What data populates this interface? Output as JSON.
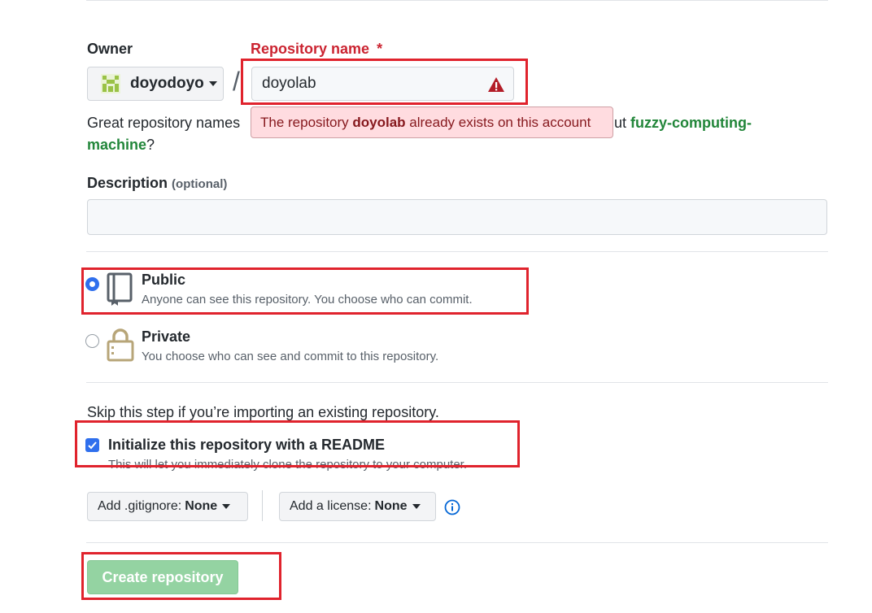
{
  "owner": {
    "label": "Owner",
    "value": "doyodoyo"
  },
  "repository_name": {
    "label": "Repository name",
    "required_mark": "*",
    "value": "doyolab",
    "separator": "/"
  },
  "error_tooltip": {
    "prefix": "The repository ",
    "repo": "doyolab",
    "suffix": " already exists on this account"
  },
  "hint": {
    "text_before": "Great repository names",
    "text_after": "ut",
    "suggestion_part1": "fuzzy-computing-",
    "suggestion_part2": "machine",
    "end": "?"
  },
  "description": {
    "label": "Description",
    "optional": "(optional)",
    "value": ""
  },
  "visibility": [
    {
      "title": "Public",
      "subtitle": "Anyone can see this repository. You choose who can commit.",
      "selected": true
    },
    {
      "title": "Private",
      "subtitle": "You choose who can see and commit to this repository.",
      "selected": false
    }
  ],
  "init": {
    "skip_text": "Skip this step if you’re importing an existing repository.",
    "readme_label": "Initialize this repository with a README",
    "readme_sub": "This will let you immediately clone the repository to your computer.",
    "checked": true
  },
  "gitignore": {
    "label": "Add .gitignore:",
    "value": "None"
  },
  "license": {
    "label": "Add a license:",
    "value": "None"
  },
  "create_button": "Create repository",
  "colors": {
    "accent_blue": "#2f6fed",
    "error_red": "#cb2431",
    "highlight_red": "#e0232d",
    "create_green": "#94d3a2",
    "suggestion_green": "#22863a"
  }
}
